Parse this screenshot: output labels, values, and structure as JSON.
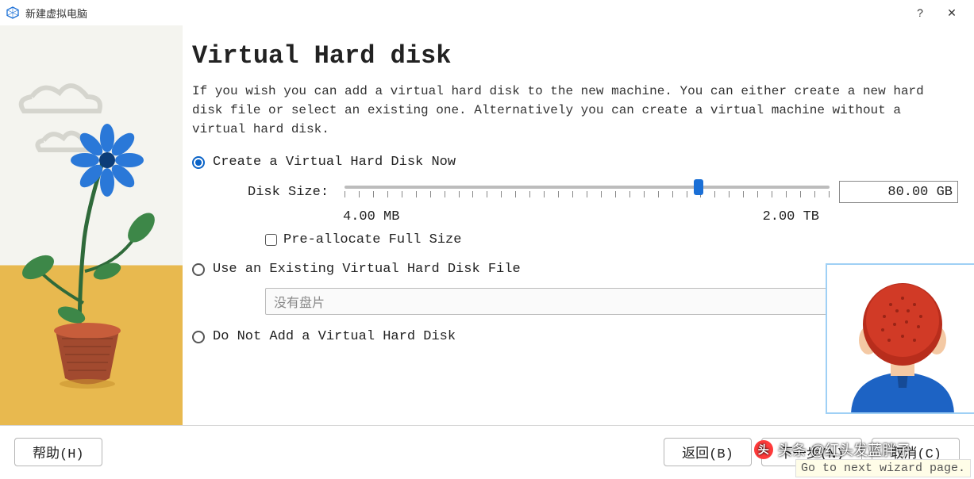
{
  "window": {
    "title": "新建虚拟电脑",
    "help_icon": "?",
    "close_icon": "✕"
  },
  "page": {
    "heading": "Virtual Hard disk",
    "description": "If you wish you can add a virtual hard disk to the new machine. You can either create a new hard disk file or select an existing one. Alternatively you can create a virtual machine without a virtual hard disk."
  },
  "options": {
    "create_now": "Create a Virtual Hard Disk Now",
    "use_existing": "Use an Existing Virtual Hard Disk File",
    "do_not_add": "Do Not Add a Virtual Hard Disk"
  },
  "disk": {
    "size_label": "Disk Size:",
    "size_value": "80.00 GB",
    "min_label": "4.00 MB",
    "max_label": "2.00 TB",
    "preallocate": "Pre-allocate Full Size",
    "slider_percent": 73
  },
  "existing": {
    "dropdown_text": "没有盘片"
  },
  "footer": {
    "help": "帮助(H)",
    "back": "返回(B)",
    "next": "下一步(N)",
    "cancel": "取消(C)"
  },
  "tooltip": "Go to next wizard page.",
  "watermark": "头条 @红头发蓝胖子"
}
